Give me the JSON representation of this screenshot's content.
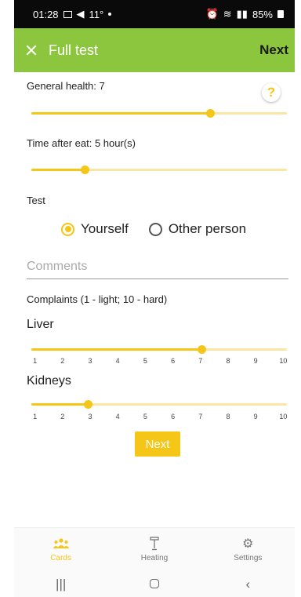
{
  "status_bar": {
    "time": "01:28",
    "temp": "11°",
    "battery": "85%"
  },
  "header": {
    "title": "Full test",
    "next_label": "Next"
  },
  "help": {
    "glyph": "?"
  },
  "general_health": {
    "label": "General health: 7",
    "value": 7,
    "min": 0,
    "max": 10
  },
  "time_after_eat": {
    "label": "Time after eat: 5 hour(s)",
    "value": 5,
    "min": 0,
    "max": 24
  },
  "test": {
    "label": "Test",
    "options": [
      {
        "label": "Yourself",
        "checked": true
      },
      {
        "label": "Other person",
        "checked": false
      }
    ]
  },
  "comments": {
    "placeholder": "Comments",
    "value": ""
  },
  "complaints": {
    "label": "Complaints (1 - light; 10 - hard)"
  },
  "liver": {
    "label": "Liver",
    "value": 7,
    "min": 1,
    "max": 10
  },
  "kidneys": {
    "label": "Kidneys",
    "value": 3,
    "min": 1,
    "max": 10
  },
  "scale_ticks": [
    "1",
    "2",
    "3",
    "4",
    "5",
    "6",
    "7",
    "8",
    "9",
    "10"
  ],
  "next_button": {
    "label": "Next"
  },
  "bottom_nav": {
    "items": [
      {
        "label": "Cards",
        "icon": "people-icon",
        "active": true
      },
      {
        "label": "Heating",
        "icon": "heater-icon",
        "active": false
      },
      {
        "label": "Settings",
        "icon": "gear-icon",
        "active": false
      }
    ]
  },
  "colors": {
    "accent": "#f5c518",
    "header": "#8cc63f",
    "track": "#fbe5a4"
  }
}
